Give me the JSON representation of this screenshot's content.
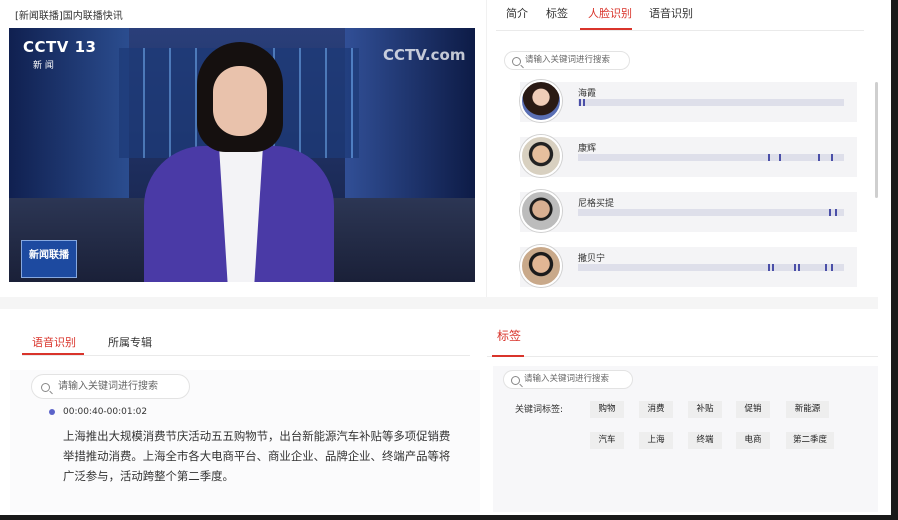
{
  "header": {
    "title": "[新闻联播]国内联播快讯"
  },
  "video": {
    "channel_logo": "CCTV 13",
    "channel_sub": "新 闻",
    "watermark": "CCTV.com",
    "program_badge": "新闻联播"
  },
  "top_tabs": [
    {
      "label": "简介"
    },
    {
      "label": "标签"
    },
    {
      "label": "人脸识别"
    },
    {
      "label": "语音识别"
    }
  ],
  "face_search": {
    "placeholder": "请输入关键词进行搜索"
  },
  "faces": [
    {
      "name": "海霞",
      "marks": [
        0.003,
        0.018
      ]
    },
    {
      "name": "康辉",
      "marks": [
        0.72,
        0.76,
        0.91,
        0.96
      ]
    },
    {
      "name": "尼格买提",
      "marks": [
        0.95,
        0.975
      ]
    },
    {
      "name": "撒贝宁",
      "marks": [
        0.72,
        0.735,
        0.82,
        0.835,
        0.935,
        0.96
      ]
    }
  ],
  "bottom_tabs": [
    {
      "label": "语音识别"
    },
    {
      "label": "所属专辑"
    }
  ],
  "speech": {
    "search_placeholder": "请输入关键词进行搜索",
    "time_range": "00:00:40-00:01:02",
    "text": "上海推出大规模消费节庆活动五五购物节，出台新能源汽车补贴等多项促销费举措推动消费。上海全市各大电商平台、商业企业、品牌企业、终端产品等将广泛参与，活动跨整个第二季度。"
  },
  "tags": {
    "title": "标签",
    "search_placeholder": "请输入关键词进行搜索",
    "keyword_label": "关键词标签:",
    "row1": [
      "购物",
      "消费",
      "补贴",
      "促销",
      "新能源"
    ],
    "row2": [
      "汽车",
      "上海",
      "终端",
      "电商",
      "第二季度"
    ]
  },
  "colors": {
    "accent": "#d9342b",
    "timeline_mark": "#4b4fa8"
  }
}
